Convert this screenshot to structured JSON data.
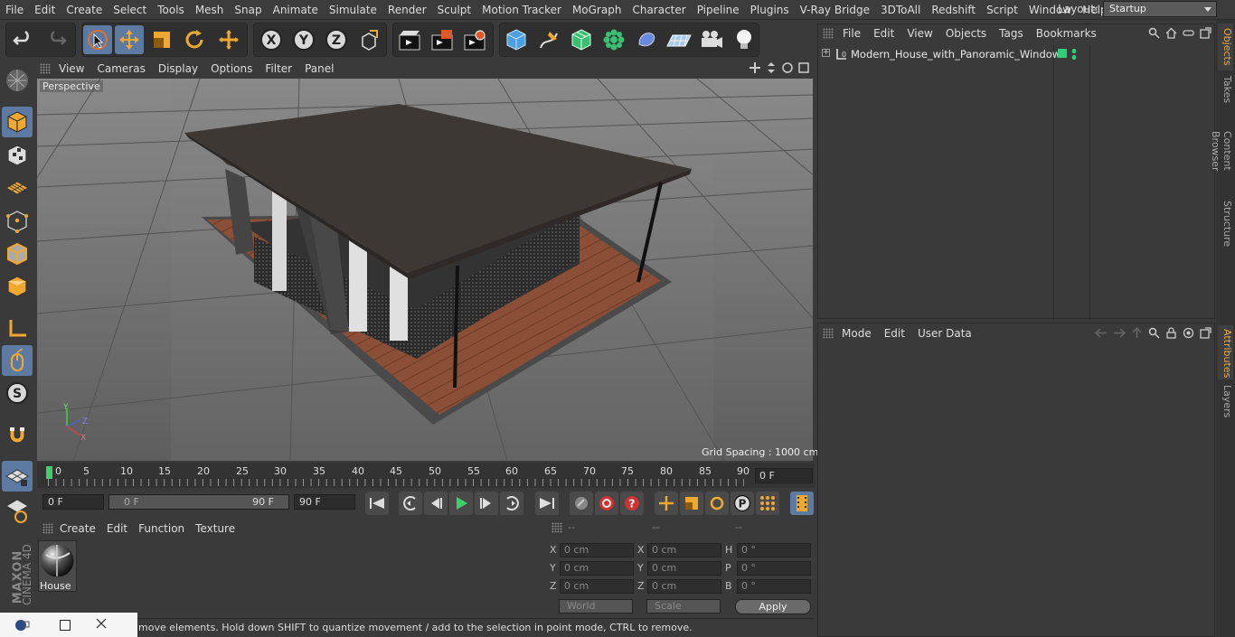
{
  "menubar": {
    "items": [
      "File",
      "Edit",
      "Create",
      "Select",
      "Tools",
      "Mesh",
      "Snap",
      "Animate",
      "Simulate",
      "Render",
      "Sculpt",
      "Motion Tracker",
      "MoGraph",
      "Character",
      "Pipeline",
      "Plugins",
      "V-Ray Bridge",
      "3DToAll",
      "Redshift",
      "Script",
      "Window",
      "Help"
    ],
    "layout_label": "Layout:",
    "layout_value": "Startup"
  },
  "viewport": {
    "menu": [
      "View",
      "Cameras",
      "Display",
      "Options",
      "Filter",
      "Panel"
    ],
    "camera_label": "Perspective",
    "grid_spacing": "Grid Spacing : 1000 cm",
    "axis_labels": {
      "y": "Y",
      "z": "Z",
      "x": "X"
    }
  },
  "timeline": {
    "ticks": [
      "0",
      "5",
      "10",
      "15",
      "20",
      "25",
      "30",
      "35",
      "40",
      "45",
      "50",
      "55",
      "60",
      "65",
      "70",
      "75",
      "80",
      "85",
      "90"
    ],
    "current_frame": "0 F"
  },
  "playback": {
    "start_field": "0 F",
    "range_start": "0 F",
    "range_end": "90 F",
    "end_field": "90 F"
  },
  "materials": {
    "menu": [
      "Create",
      "Edit",
      "Function",
      "Texture"
    ],
    "items": [
      {
        "name": "House"
      }
    ]
  },
  "coordinates": {
    "headers": [
      "--",
      "--",
      "--"
    ],
    "rows": [
      {
        "l1": "X",
        "v1": "0 cm",
        "l2": "X",
        "v2": "0 cm",
        "l3": "H",
        "v3": "0 °"
      },
      {
        "l1": "Y",
        "v1": "0 cm",
        "l2": "Y",
        "v2": "0 cm",
        "l3": "P",
        "v3": "0 °"
      },
      {
        "l1": "Z",
        "v1": "0 cm",
        "l2": "Z",
        "v2": "0 cm",
        "l3": "B",
        "v3": "0 °"
      }
    ],
    "world_select": "World",
    "scale_select": "Scale",
    "apply_label": "Apply"
  },
  "status": {
    "text": "move elements. Hold down SHIFT to quantize movement / add to the selection in point mode, CTRL to remove."
  },
  "objects": {
    "menu": [
      "File",
      "Edit",
      "View",
      "Objects",
      "Tags",
      "Bookmarks"
    ],
    "items": [
      {
        "name": "Modern_House_with_Panoramic_Windows"
      }
    ]
  },
  "attributes": {
    "menu": [
      "Mode",
      "Edit",
      "User Data"
    ]
  },
  "sidetabs": {
    "top": [
      "Objects",
      "Takes",
      "Content Browser",
      "Structure"
    ],
    "bottom": [
      "Attributes",
      "Layers"
    ]
  },
  "brand": {
    "vendor": "MAXON",
    "product": "CINEMA 4D"
  },
  "colors": {
    "accent": "#5d7ba2",
    "active_tab": "#e9a94c",
    "play_green": "#3ecf6a",
    "tag_green": "#2fcf7a"
  }
}
